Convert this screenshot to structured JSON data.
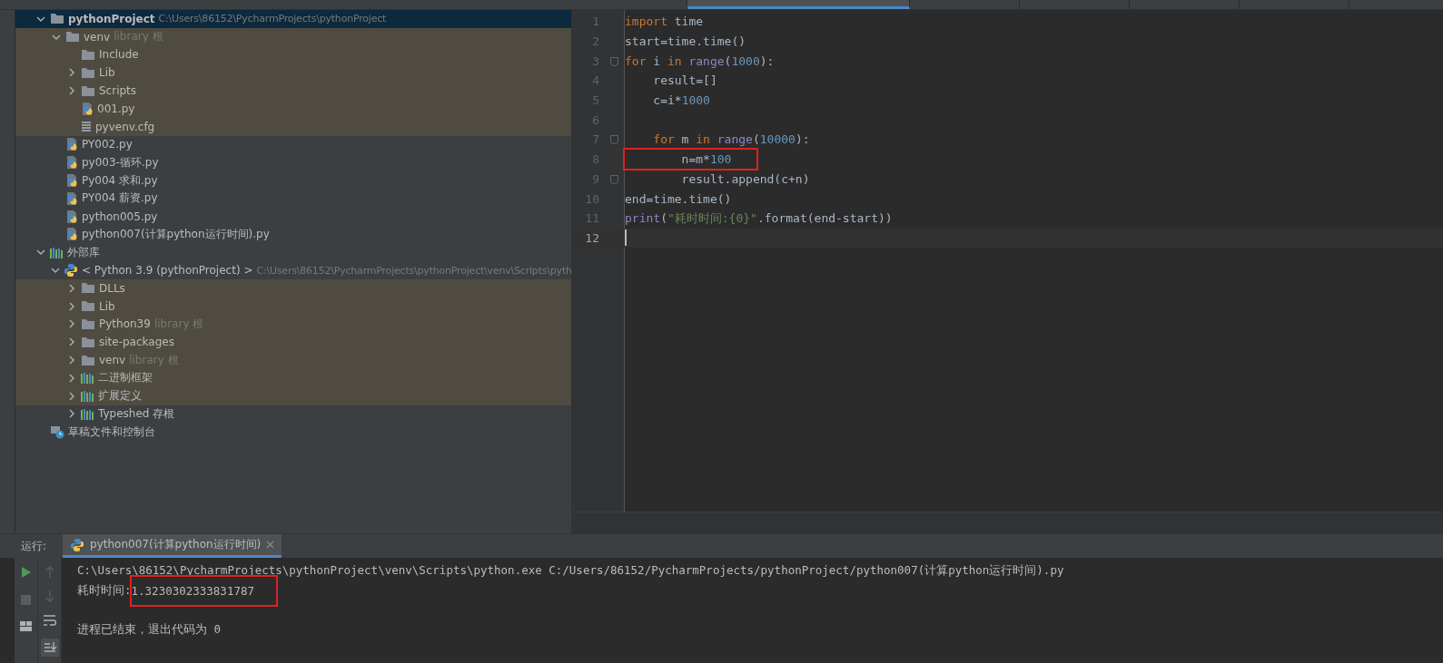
{
  "editor_tabs": [
    {
      "selected": false
    },
    {
      "selected": true
    },
    {
      "selected": false
    },
    {
      "selected": false
    },
    {
      "selected": false
    },
    {
      "selected": false
    }
  ],
  "project_tree": [
    {
      "kind": "folder",
      "name": "pythonProject",
      "path": "C:\\Users\\86152\\PycharmProjects\\pythonProject",
      "expanded": true,
      "selected": true,
      "excluded": false,
      "children": [
        {
          "kind": "folder",
          "name": "venv",
          "hint": "library 根",
          "expanded": true,
          "selected": false,
          "excluded": true,
          "children": [
            {
              "kind": "folder",
              "name": "Include",
              "selected": false,
              "excluded": true
            },
            {
              "kind": "folder",
              "name": "Lib",
              "expanded": false,
              "selected": false,
              "excluded": true
            },
            {
              "kind": "folder",
              "name": "Scripts",
              "expanded": false,
              "selected": false,
              "excluded": true
            },
            {
              "kind": "python",
              "name": "001.py",
              "selected": false,
              "excluded": true
            },
            {
              "kind": "config",
              "name": "pyvenv.cfg",
              "selected": false,
              "excluded": true
            }
          ]
        },
        {
          "kind": "python",
          "name": "PY002.py",
          "selected": false,
          "excluded": false
        },
        {
          "kind": "python",
          "name": "py003-循环.py",
          "selected": false,
          "excluded": false
        },
        {
          "kind": "python",
          "name": "Py004 求和.py",
          "selected": false,
          "excluded": false
        },
        {
          "kind": "python",
          "name": "PY004  薪资.py",
          "selected": false,
          "excluded": false
        },
        {
          "kind": "python",
          "name": "python005.py",
          "selected": false,
          "excluded": false
        },
        {
          "kind": "python",
          "name": "python007(计算python运行时间).py",
          "selected": false,
          "excluded": false
        }
      ]
    },
    {
      "kind": "library",
      "name": "外部库",
      "expanded": true,
      "selected": false,
      "excluded": false,
      "children": [
        {
          "kind": "sdk",
          "name": "< Python 3.9 (pythonProject) >",
          "path": "C:\\Users\\86152\\PycharmProjects\\pythonProject\\venv\\Scripts\\pyth",
          "expanded": true,
          "selected": false,
          "excluded": false,
          "children": [
            {
              "kind": "folder",
              "name": "DLLs",
              "expanded": false,
              "selected": false,
              "excluded": true
            },
            {
              "kind": "folder",
              "name": "Lib",
              "expanded": false,
              "selected": false,
              "excluded": true
            },
            {
              "kind": "folder",
              "name": "Python39",
              "hint": "library 根",
              "expanded": false,
              "selected": false,
              "excluded": true
            },
            {
              "kind": "folder",
              "name": "site-packages",
              "expanded": false,
              "selected": false,
              "excluded": true
            },
            {
              "kind": "folder",
              "name": "venv",
              "hint": "library 根",
              "expanded": false,
              "selected": false,
              "excluded": true
            },
            {
              "kind": "library",
              "name": "二进制框架",
              "expanded": false,
              "selected": false,
              "excluded": true
            },
            {
              "kind": "library",
              "name": "扩展定义",
              "expanded": false,
              "selected": false,
              "excluded": true
            },
            {
              "kind": "library",
              "name": "Typeshed 存根",
              "expanded": false,
              "selected": false,
              "excluded": false
            }
          ]
        }
      ]
    },
    {
      "kind": "scratch",
      "name": "草稿文件和控制台",
      "selected": false,
      "excluded": false
    }
  ],
  "code_lines": [
    {
      "number": "1",
      "fold": false,
      "current": false,
      "boxed": false,
      "tokens": [
        {
          "kind": "keyword",
          "text": "import"
        },
        {
          "kind": "plain",
          "text": " time"
        }
      ]
    },
    {
      "number": "2",
      "fold": false,
      "current": false,
      "boxed": false,
      "tokens": [
        {
          "kind": "plain",
          "text": "start=time.time()"
        }
      ]
    },
    {
      "number": "3",
      "fold": true,
      "current": false,
      "boxed": false,
      "tokens": [
        {
          "kind": "keyword",
          "text": "for"
        },
        {
          "kind": "plain",
          "text": " i "
        },
        {
          "kind": "keyword",
          "text": "in "
        },
        {
          "kind": "builtin",
          "text": "range"
        },
        {
          "kind": "plain",
          "text": "("
        },
        {
          "kind": "number",
          "text": "1000"
        },
        {
          "kind": "plain",
          "text": "):"
        }
      ]
    },
    {
      "number": "4",
      "fold": false,
      "current": false,
      "boxed": false,
      "tokens": [
        {
          "kind": "plain",
          "text": "    result=[]"
        }
      ]
    },
    {
      "number": "5",
      "fold": false,
      "current": false,
      "boxed": false,
      "tokens": [
        {
          "kind": "plain",
          "text": "    c=i*"
        },
        {
          "kind": "number",
          "text": "1000"
        }
      ]
    },
    {
      "number": "6",
      "fold": false,
      "current": false
    },
    {
      "number": "7",
      "fold": true,
      "current": false,
      "boxed": false,
      "tokens": [
        {
          "kind": "keyword",
          "text": "    for"
        },
        {
          "kind": "plain",
          "text": " m "
        },
        {
          "kind": "keyword",
          "text": "in "
        },
        {
          "kind": "builtin",
          "text": "range"
        },
        {
          "kind": "plain",
          "text": "("
        },
        {
          "kind": "number",
          "text": "10000"
        },
        {
          "kind": "plain",
          "text": "):"
        }
      ]
    },
    {
      "number": "8",
      "fold": false,
      "current": false,
      "boxed": true,
      "tokens": [
        {
          "kind": "plain",
          "text": "        n=m*"
        },
        {
          "kind": "number",
          "text": "100"
        }
      ]
    },
    {
      "number": "9",
      "fold": true,
      "current": false,
      "boxed": false,
      "tokens": [
        {
          "kind": "plain",
          "text": "        result.append(c+n)"
        }
      ]
    },
    {
      "number": "10",
      "fold": false,
      "current": false,
      "boxed": false,
      "tokens": [
        {
          "kind": "plain",
          "text": "end=time.time()"
        }
      ]
    },
    {
      "number": "11",
      "fold": false,
      "current": false,
      "boxed": false,
      "tokens": [
        {
          "kind": "builtin",
          "text": "print"
        },
        {
          "kind": "plain",
          "text": "("
        },
        {
          "kind": "string",
          "text": "\"耗时时间:{0}\""
        },
        {
          "kind": "plain",
          "text": ".format(end-start))"
        }
      ]
    },
    {
      "number": "12",
      "fold": false,
      "current": true
    }
  ],
  "run_panel": {
    "label": "运行:",
    "tab": "python007(计算python运行时间)",
    "output": [
      {
        "text": "C:\\Users\\86152\\PycharmProjects\\pythonProject\\venv\\Scripts\\python.exe C:/Users/86152/PycharmProjects/pythonProject/python007(计算python运行时间).py"
      },
      {
        "text": "耗时时间:",
        "boxed": "1.3230302333831787"
      },
      {
        "text": "进程已结束，退出代码为 0"
      }
    ]
  }
}
